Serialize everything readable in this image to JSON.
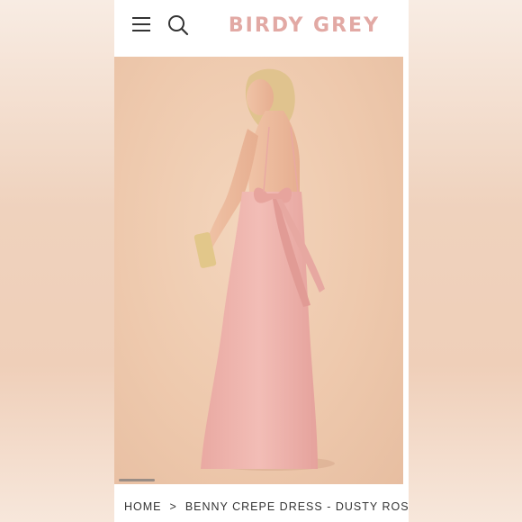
{
  "brand": {
    "logo_text": "BIRDY GREY",
    "logo_color": "#e2a9a4"
  },
  "header": {
    "menu_icon": "hamburger-menu-icon",
    "search_icon": "search-icon"
  },
  "product_image": {
    "description_colors": {
      "background": "#eec9ad",
      "dress": "#f1b7b1"
    }
  },
  "breadcrumb": {
    "home": "HOME",
    "separator": ">",
    "current": "BENNY CREPE DRESS - DUSTY ROSE"
  }
}
